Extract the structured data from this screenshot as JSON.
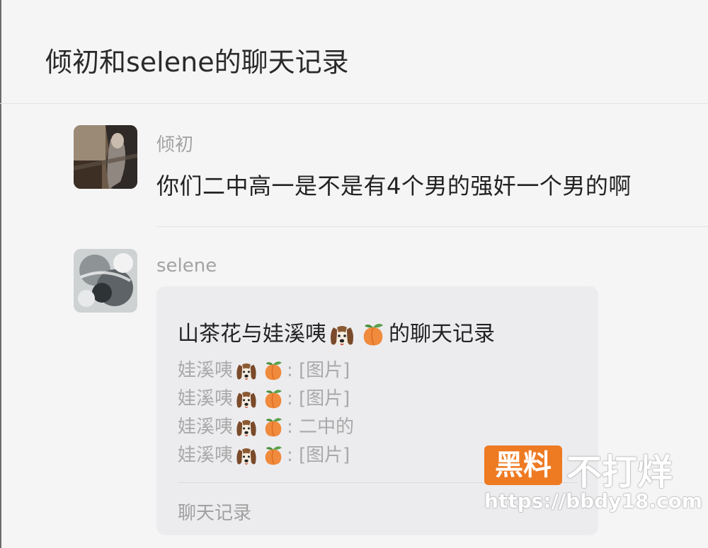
{
  "header": {
    "title": "倾初和selene的聊天记录"
  },
  "messages": [
    {
      "sender": "倾初",
      "text": "你们二中高一是不是有4个男的强奸一个男的啊"
    },
    {
      "sender": "selene",
      "card": {
        "title_prefix": "山茶花与娃溪咦",
        "title_suffix": "的聊天记录",
        "preview_sender": "娃溪咦",
        "lines": [
          ": [图片]",
          ": [图片]",
          ": 二中的",
          ": [图片]"
        ],
        "footer": "聊天记录"
      }
    }
  ],
  "icons": {
    "emoji_1": "dog-face-icon",
    "emoji_2": "peach-icon"
  },
  "watermark": {
    "badge": "黑料",
    "text": "不打烊",
    "url": "https://bbdy18.com"
  },
  "colors": {
    "watermark_orange": "#ee7a22",
    "background": "#f5f5f5",
    "card": "#ececef"
  }
}
